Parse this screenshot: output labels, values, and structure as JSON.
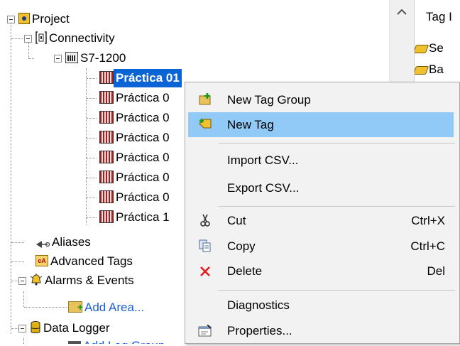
{
  "tree": {
    "project": "Project",
    "connectivity": "Connectivity",
    "device": "S7-1200",
    "groups": [
      "Práctica 01",
      "Práctica 0",
      "Práctica 0",
      "Práctica 0",
      "Práctica 0",
      "Práctica 0",
      "Práctica 0",
      "Práctica 1"
    ],
    "aliases": "Aliases",
    "advanced_tags": "Advanced Tags",
    "alarms": "Alarms & Events",
    "add_area": "Add Area...",
    "data_logger": "Data Logger",
    "add_log": "Add Log Group"
  },
  "right_pane": {
    "header": "Tag I",
    "items": [
      "Se",
      "Ba"
    ]
  },
  "scrollbar": {
    "up": "^"
  },
  "context_menu": {
    "items": [
      {
        "label": "New Tag Group",
        "shortcut": "",
        "icon": "new-tag-group-icon"
      },
      {
        "label": "New Tag",
        "shortcut": "",
        "icon": "new-tag-icon"
      },
      {
        "label": "Import CSV...",
        "shortcut": "",
        "icon": ""
      },
      {
        "label": "Export CSV...",
        "shortcut": "",
        "icon": ""
      },
      {
        "label": "Cut",
        "shortcut": "Ctrl+X",
        "icon": "scissors-icon"
      },
      {
        "label": "Copy",
        "shortcut": "Ctrl+C",
        "icon": "copy-icon"
      },
      {
        "label": "Delete",
        "shortcut": "Del",
        "icon": "delete-x-icon"
      },
      {
        "label": "Diagnostics",
        "shortcut": "",
        "icon": ""
      },
      {
        "label": "Properties...",
        "shortcut": "",
        "icon": "properties-icon"
      }
    ],
    "highlighted": "New Tag"
  },
  "colors": {
    "selection": "#0a64d6",
    "menu_highlight": "#91c9f7",
    "link_blue": "#1a5fd6",
    "delete_red": "#e02020"
  }
}
